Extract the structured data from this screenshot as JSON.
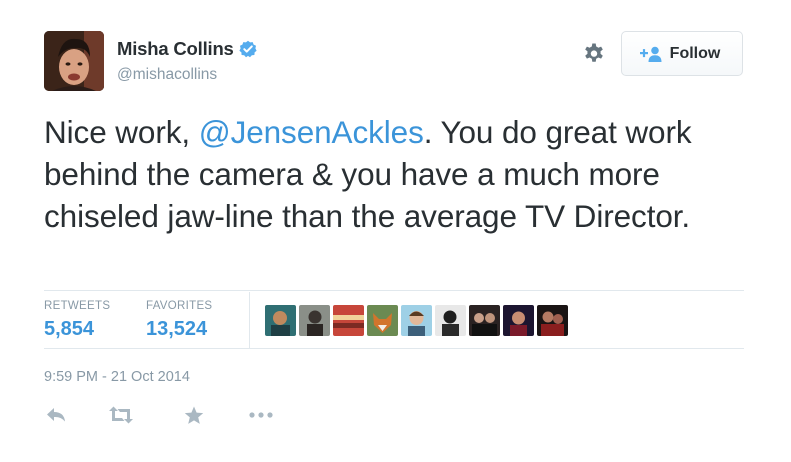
{
  "user": {
    "full_name": "Misha Collins",
    "username": "@mishacollins",
    "verified": true,
    "avatar_icon": "profile-photo"
  },
  "header": {
    "settings_icon": "gear-icon",
    "follow_label": "Follow",
    "follow_icon": "add-user-icon"
  },
  "tweet": {
    "text_before": "Nice work, ",
    "mention": "@JensenAckles",
    "text_after": ". You do great work behind the camera & you have a much more chiseled jaw-line than the average TV Director."
  },
  "stats": {
    "retweets_label": "RETWEETS",
    "retweets_value": "5,854",
    "favorites_label": "FAVORITES",
    "favorites_value": "13,524"
  },
  "favorited_by_count_shown": 9,
  "timestamp": "9:59 PM - 21 Oct 2014",
  "actions": [
    {
      "icon": "reply-icon"
    },
    {
      "icon": "retweet-icon"
    },
    {
      "icon": "favorite-star-icon"
    },
    {
      "icon": "more-dots-icon"
    }
  ],
  "colors": {
    "link": "#3b94d9",
    "text": "#292f33",
    "muted": "#8899a6",
    "verified": "#55acee",
    "action_icon": "#aab8c2"
  }
}
